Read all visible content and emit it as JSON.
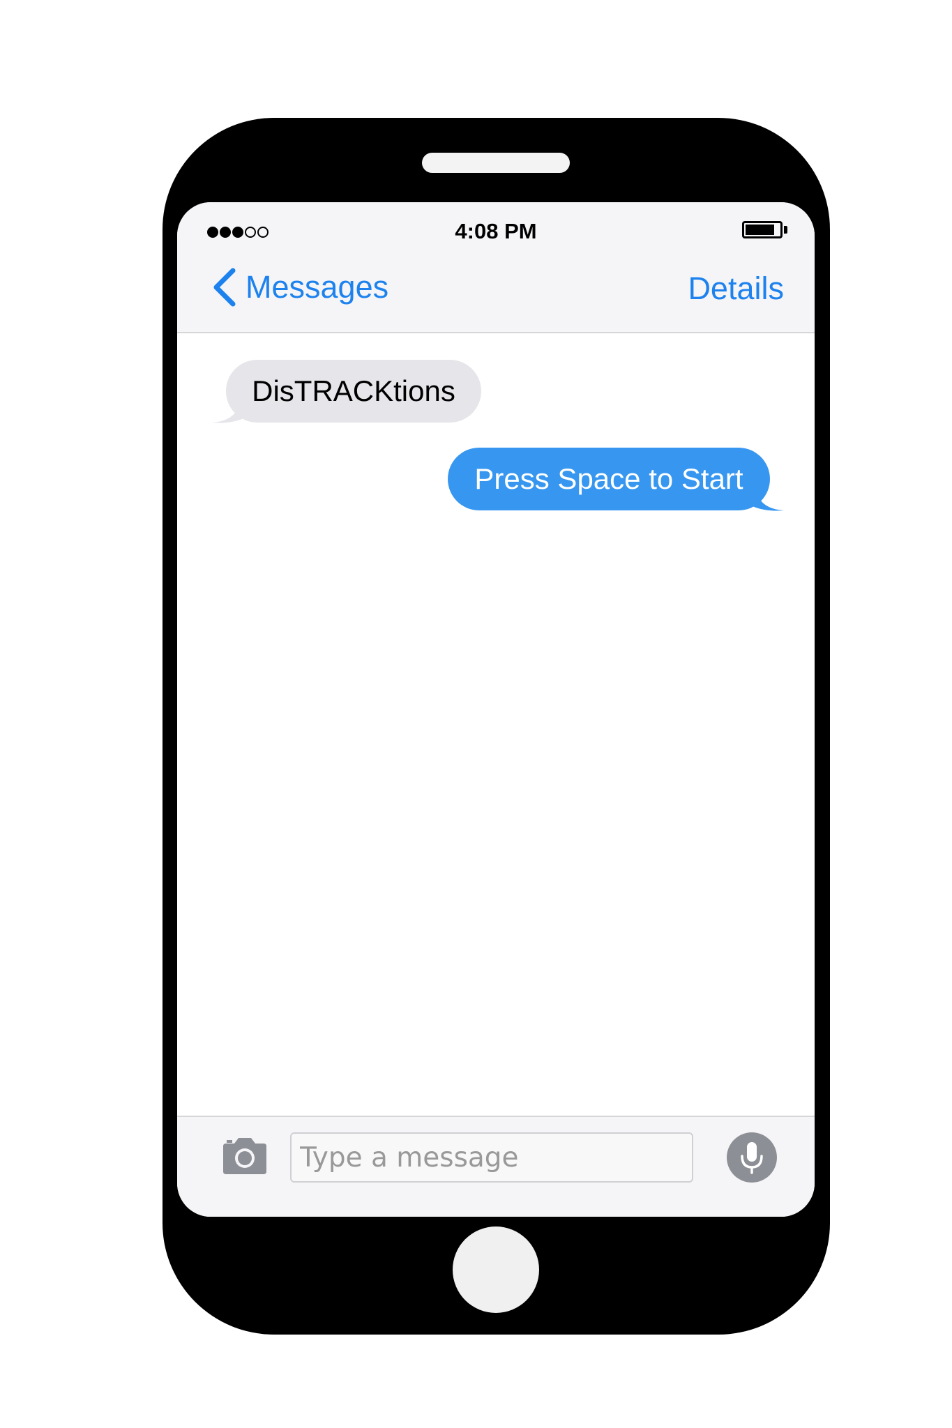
{
  "status_bar": {
    "time": "4:08 PM",
    "signal_bars_filled": 3,
    "signal_bars_total": 5,
    "battery_level": 0.85
  },
  "nav": {
    "back_label": "Messages",
    "details_label": "Details"
  },
  "messages": [
    {
      "direction": "received",
      "text": "DisTRACKtions"
    },
    {
      "direction": "sent",
      "text": "Press Space to Start"
    }
  ],
  "composer": {
    "placeholder": "Type a message",
    "value": ""
  },
  "icons": {
    "back": "chevron-left-icon",
    "camera": "camera-icon",
    "mic": "microphone-icon"
  },
  "colors": {
    "phone_frame": "#000000",
    "accent_blue": "#1d82ee",
    "sent_bubble": "#3797f0",
    "received_bubble": "#e5e5ea",
    "mic_button": "#8c8f96"
  }
}
